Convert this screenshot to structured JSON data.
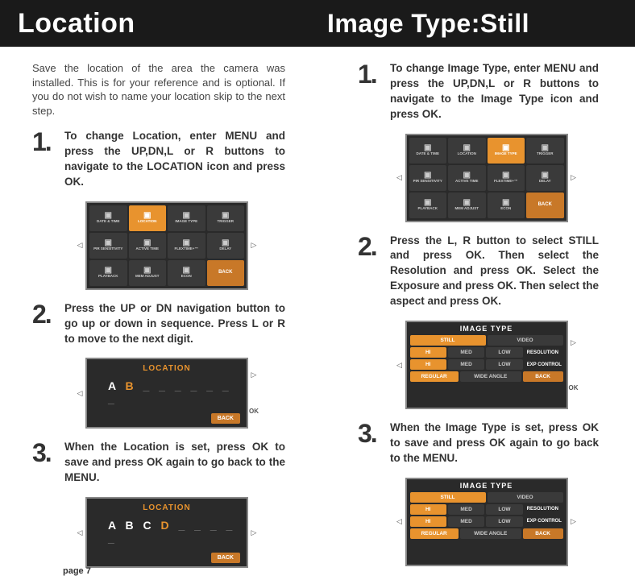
{
  "page_label": "page 7",
  "left": {
    "title": "Location",
    "intro": "Save the location of the area the camera was installed. This is for your reference and is optional. If you do not wish to name your location skip to the next step.",
    "steps": [
      {
        "num": "1.",
        "text": "To change Location, enter MENU and press the UP,DN,L or R buttons to navigate to the LOCATION icon and press OK."
      },
      {
        "num": "2.",
        "text": "Press the UP or DN navigation button to go up or down in sequence. Press L or R to move to the next digit."
      },
      {
        "num": "3.",
        "text": "When the Location is set, press OK to save and press OK again to go back to the MENU."
      }
    ],
    "fig1_menu": {
      "cells": [
        "DATE & TIME",
        "LOCATION",
        "IMAGE TYPE",
        "TRIGGER",
        "PIR SENSITIVITY",
        "ACTIVE TIME",
        "FLEXTIME+™",
        "DELAY",
        "PLAYBACK",
        "MEM ADJUST",
        "ECON",
        "BACK"
      ],
      "selected_index": 1,
      "back_index": 11
    },
    "fig2_location": {
      "title": "LOCATION",
      "chars": "A B",
      "active_after": true,
      "underline": "_ _ _ _ _ _ _",
      "back": "BACK",
      "ok": "OK"
    },
    "fig3_location": {
      "title": "LOCATION",
      "chars": "A B C D",
      "active_after": true,
      "underline": "_ _ _ _ _",
      "back": "BACK"
    }
  },
  "right": {
    "title": "Image Type:Still",
    "steps": [
      {
        "num": "1.",
        "text": "To change Image Type, enter MENU and press the UP,DN,L or R buttons to navigate to the Image Type icon and press OK."
      },
      {
        "num": "2.",
        "text": "Press the L, R button to select STILL and press OK. Then select the Resolution and press OK. Select the Exposure and press OK. Then select the aspect and press OK."
      },
      {
        "num": "3.",
        "text": "When the Image Type is set, press OK to save and press OK again to go back to the MENU."
      }
    ],
    "fig1_menu": {
      "cells": [
        "DATE & TIME",
        "LOCATION",
        "IMAGE TYPE",
        "TRIGGER",
        "PIR SENSITIVITY",
        "ACTIVE TIME",
        "FLEXTIME+™",
        "DELAY",
        "PLAYBACK",
        "MEM ADJUST",
        "ECON",
        "BACK"
      ],
      "selected_index": 2,
      "back_index": 11
    },
    "fig2_it": {
      "title": "IMAGE TYPE",
      "row_type": {
        "still": "STILL",
        "video": "VIDEO",
        "sel": "still"
      },
      "row_res": {
        "opts": [
          "HI",
          "MED",
          "LOW"
        ],
        "sel": 0,
        "label": "RESOLUTION"
      },
      "row_exp": {
        "opts": [
          "HI",
          "MED",
          "LOW"
        ],
        "sel": 0,
        "label": "EXP CONTROL"
      },
      "row_asp": {
        "opts": [
          "REGULAR",
          "WIDE ANGLE"
        ],
        "sel": 0,
        "back": "BACK"
      },
      "ok": "OK"
    },
    "fig3_it": {
      "title": "IMAGE TYPE",
      "row_type": {
        "still": "STILL",
        "video": "VIDEO",
        "sel": "still"
      },
      "row_res": {
        "opts": [
          "HI",
          "MED",
          "LOW"
        ],
        "sel": 0,
        "label": "RESOLUTION"
      },
      "row_exp": {
        "opts": [
          "HI",
          "MED",
          "LOW"
        ],
        "sel": 0,
        "label": "EXP CONTROL"
      },
      "row_asp": {
        "opts": [
          "REGULAR",
          "WIDE ANGLE"
        ],
        "sel": 0,
        "back": "BACK"
      }
    }
  }
}
